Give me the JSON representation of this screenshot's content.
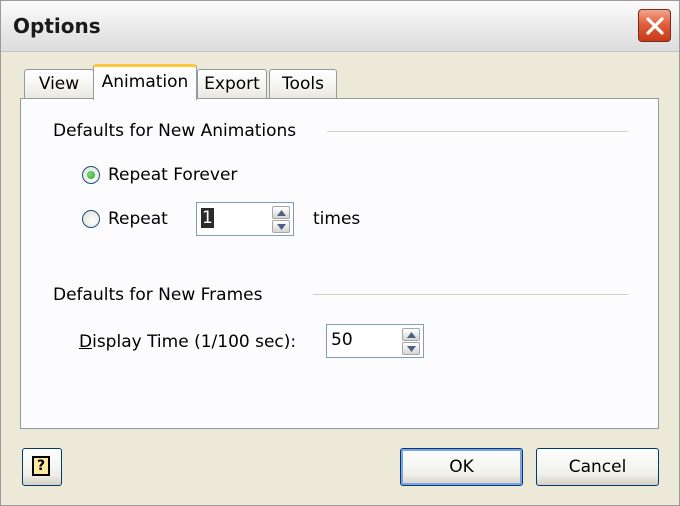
{
  "window": {
    "title": "Options"
  },
  "tabs": [
    {
      "label": "View",
      "active": false
    },
    {
      "label": "Animation",
      "active": true
    },
    {
      "label": "Export",
      "active": false
    },
    {
      "label": "Tools",
      "active": false
    }
  ],
  "animations_group": {
    "title": "Defaults for New Animations",
    "repeat_forever_label": "Repeat Forever",
    "repeat_forever_selected": true,
    "repeat_label": "Repeat",
    "repeat_selected": false,
    "repeat_count": "1",
    "times_label": "times"
  },
  "frames_group": {
    "title": "Defaults for New Frames",
    "display_time_label_first": "D",
    "display_time_label_rest": "isplay Time (1/100 sec):",
    "display_time_value": "50"
  },
  "buttons": {
    "help_glyph": "?",
    "ok_label": "OK",
    "cancel_label": "Cancel"
  },
  "colors": {
    "close_button": "#e0603c",
    "active_tab_highlight": "#ffc83c",
    "radio_dot": "#21a121",
    "default_button_ring": "#7ba2e7"
  }
}
